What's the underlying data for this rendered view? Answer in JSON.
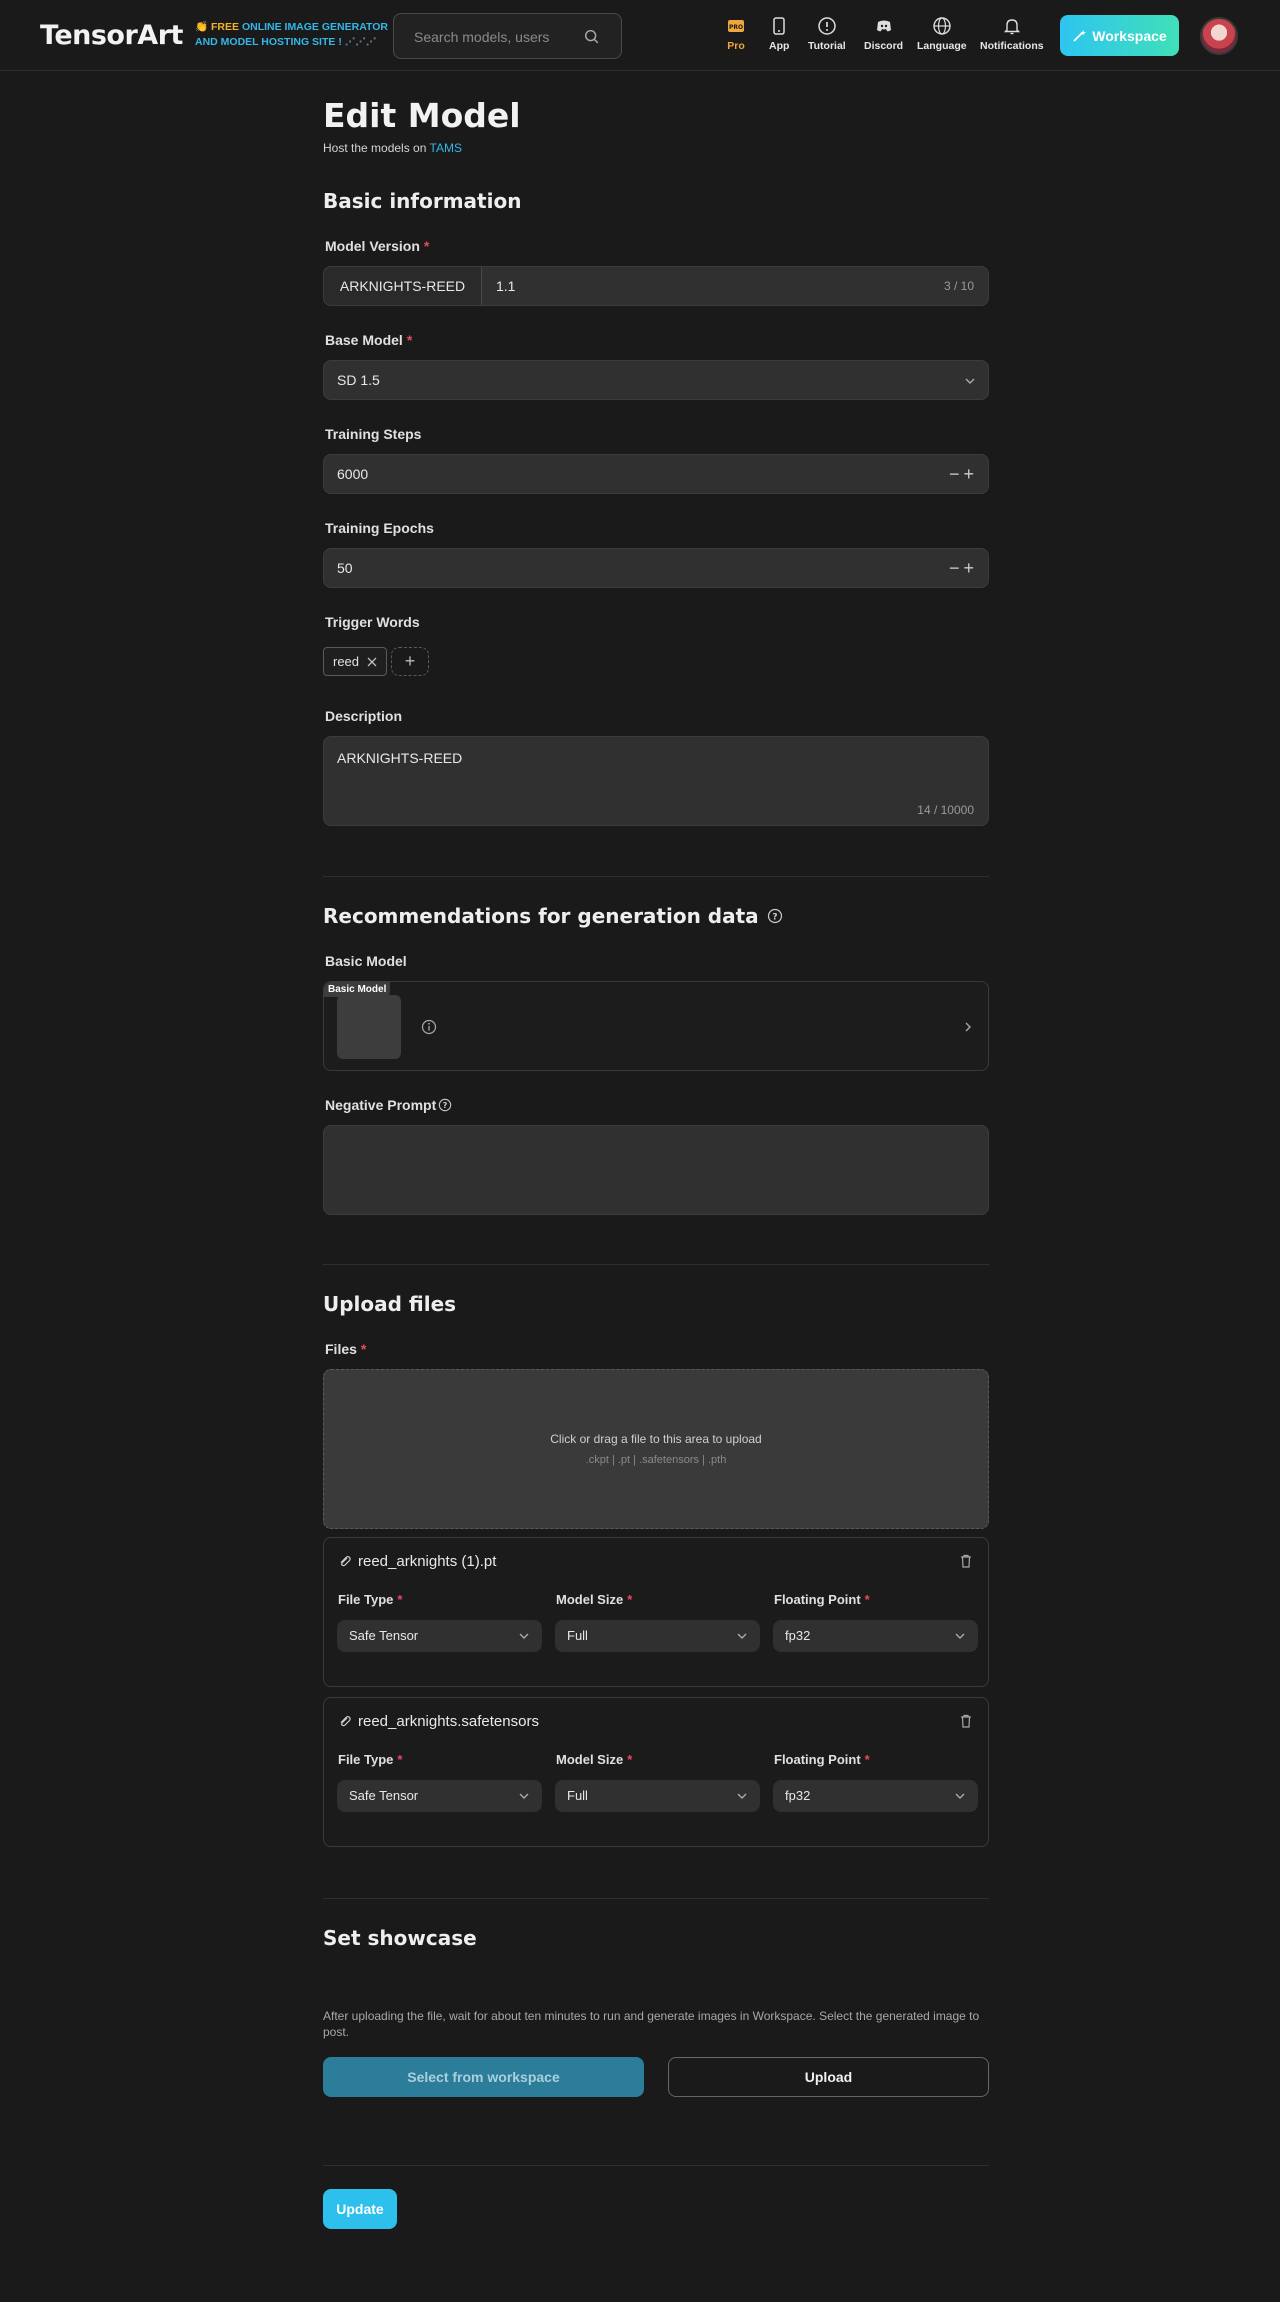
{
  "header": {
    "logo": "TensorArt",
    "tagline_icon": "👏",
    "tagline_free": "FREE",
    "tagline_line1_rest": "ONLINE IMAGE GENERATOR",
    "tagline_line2": "AND MODEL HOSTING SITE !",
    "search_placeholder": "Search models, users",
    "nav": {
      "pro": "Pro",
      "app": "App",
      "tutorial": "Tutorial",
      "discord": "Discord",
      "language": "Language",
      "notifications": "Notifications"
    },
    "workspace": "Workspace"
  },
  "page": {
    "title": "Edit Model",
    "host_prefix": "Host the models on",
    "host_link": "TAMS"
  },
  "basic_info": {
    "title": "Basic information",
    "model_version_label": "Model Version",
    "model_version_prefix": "ARKNIGHTS-REED",
    "model_version_value": "1.1",
    "model_version_counter": "3 / 10",
    "base_model_label": "Base Model",
    "base_model_value": "SD 1.5",
    "training_steps_label": "Training Steps",
    "training_steps_value": "6000",
    "training_epochs_label": "Training Epochs",
    "training_epochs_value": "50",
    "trigger_words_label": "Trigger Words",
    "trigger_words": [
      "reed"
    ],
    "description_label": "Description",
    "description_value": "ARKNIGHTS-REED",
    "description_counter": "14 / 10000"
  },
  "recommendations": {
    "title": "Recommendations for generation data",
    "basic_model_label": "Basic Model",
    "basic_model_badge": "Basic Model",
    "negative_prompt_label": "Negative Prompt"
  },
  "upload": {
    "title": "Upload files",
    "files_label": "Files",
    "dropzone_text": "Click or drag a file to this area to upload",
    "dropzone_formats": ".ckpt | .pt | .safetensors | .pth",
    "file_type_label": "File Type",
    "model_size_label": "Model Size",
    "floating_point_label": "Floating Point",
    "files": [
      {
        "name": "reed_arknights (1).pt",
        "file_type": "Safe Tensor",
        "model_size": "Full",
        "floating_point": "fp32"
      },
      {
        "name": "reed_arknights.safetensors",
        "file_type": "Safe Tensor",
        "model_size": "Full",
        "floating_point": "fp32"
      }
    ]
  },
  "showcase": {
    "title": "Set showcase",
    "info": "After uploading the file, wait for about ten minutes to run and generate images in Workspace. Select the generated image to post.",
    "select_button": "Select from workspace",
    "upload_button": "Upload"
  },
  "update_button": "Update",
  "colors": {
    "accent": "#2ec0ec",
    "required": "#e84a5f",
    "pro": "#f0a63a",
    "background": "#1a1a1a"
  }
}
